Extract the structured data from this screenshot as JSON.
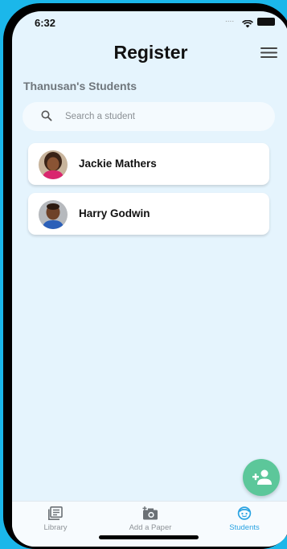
{
  "status": {
    "time": "6:32",
    "signal": "...."
  },
  "header": {
    "title": "Register"
  },
  "section": {
    "title": "Thanusan's Students"
  },
  "search": {
    "placeholder": "Search a student"
  },
  "students": [
    {
      "name": "Jackie Mathers"
    },
    {
      "name": "Harry Godwin"
    }
  ],
  "fab": {
    "icon": "add-person-icon"
  },
  "tabs": [
    {
      "label": "Library",
      "icon": "library-icon",
      "active": false
    },
    {
      "label": "Add a Paper",
      "icon": "add-photo-icon",
      "active": false
    },
    {
      "label": "Students",
      "icon": "student-face-icon",
      "active": true
    }
  ],
  "colors": {
    "background": "#e5f4fd",
    "accent": "#2aa3e2",
    "fab": "#5cc79a",
    "frame": "#1bb7ea"
  }
}
